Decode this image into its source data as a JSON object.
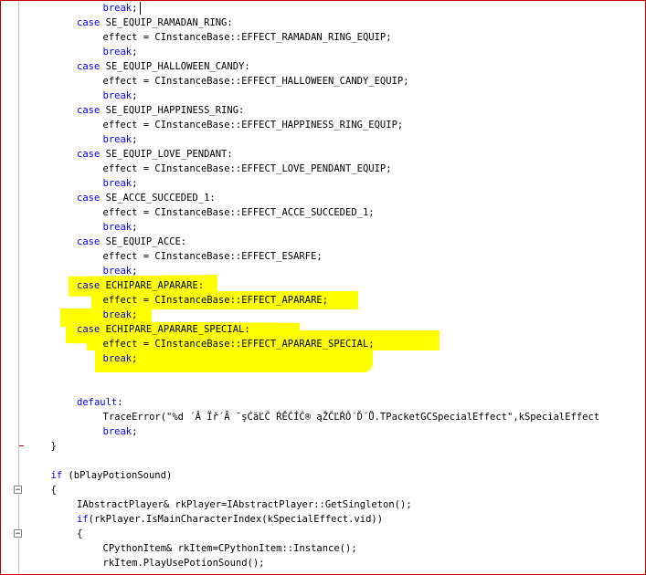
{
  "editor": {
    "lines": [
      {
        "indent": 3,
        "kw": "break",
        "text": ";"
      },
      {
        "indent": 2,
        "kw": "case",
        "text": " SE_EQUIP_RAMADAN_RING:"
      },
      {
        "indent": 3,
        "kw": "",
        "text": "effect = CInstanceBase::EFFECT_RAMADAN_RING_EQUIP;"
      },
      {
        "indent": 3,
        "kw": "break",
        "text": ";"
      },
      {
        "indent": 2,
        "kw": "case",
        "text": " SE_EQUIP_HALLOWEEN_CANDY:"
      },
      {
        "indent": 3,
        "kw": "",
        "text": "effect = CInstanceBase::EFFECT_HALLOWEEN_CANDY_EQUIP;"
      },
      {
        "indent": 3,
        "kw": "break",
        "text": ";"
      },
      {
        "indent": 2,
        "kw": "case",
        "text": " SE_EQUIP_HAPPINESS_RING:"
      },
      {
        "indent": 3,
        "kw": "",
        "text": "effect = CInstanceBase::EFFECT_HAPPINESS_RING_EQUIP;"
      },
      {
        "indent": 3,
        "kw": "break",
        "text": ";"
      },
      {
        "indent": 2,
        "kw": "case",
        "text": " SE_EQUIP_LOVE_PENDANT:"
      },
      {
        "indent": 3,
        "kw": "",
        "text": "effect = CInstanceBase::EFFECT_LOVE_PENDANT_EQUIP;"
      },
      {
        "indent": 3,
        "kw": "break",
        "text": ";"
      },
      {
        "indent": 2,
        "kw": "case",
        "text": " SE_ACCE_SUCCEDED_1:"
      },
      {
        "indent": 3,
        "kw": "",
        "text": "effect = CInstanceBase::EFFECT_ACCE_SUCCEDED_1;"
      },
      {
        "indent": 3,
        "kw": "break",
        "text": ";"
      },
      {
        "indent": 2,
        "kw": "case",
        "text": " SE_EQUIP_ACCE:"
      },
      {
        "indent": 3,
        "kw": "",
        "text": "effect = CInstanceBase::EFFECT_ESARFE;"
      },
      {
        "indent": 3,
        "kw": "break",
        "text": ";"
      },
      {
        "indent": 2,
        "kw": "case",
        "text": " ECHIPARE_APARARE:"
      },
      {
        "indent": 3,
        "kw": "",
        "text": "effect = CInstanceBase::EFFECT_APARARE;"
      },
      {
        "indent": 3,
        "kw": "break",
        "text": ";"
      },
      {
        "indent": 2,
        "kw": "case",
        "text": " ECHIPARE_APARARE_SPECIAL:"
      },
      {
        "indent": 3,
        "kw": "",
        "text": "effect = CInstanceBase::EFFECT_APARARE_SPECIAL;"
      },
      {
        "indent": 3,
        "kw": "break",
        "text": ";"
      },
      {
        "indent": 0,
        "kw": "",
        "text": ""
      },
      {
        "indent": 0,
        "kw": "",
        "text": ""
      },
      {
        "indent": 2,
        "kw": "default",
        "text": ":"
      },
      {
        "indent": 3,
        "kw": "",
        "text": "TraceError(\"%d ´Â Ïř´Â ˘şĆăĽČ ŔĚĆÍĆ® ąŽČĽŔÔ´Ď´Ů.TPacketGCSpecialEffect\",kSpecialEffect"
      },
      {
        "indent": 3,
        "kw": "break",
        "text": ";"
      },
      {
        "indent": 1,
        "kw": "",
        "text": "}"
      },
      {
        "indent": 0,
        "kw": "",
        "text": ""
      },
      {
        "indent": 1,
        "kw": "if",
        "text": " (bPlayPotionSound)"
      },
      {
        "indent": 1,
        "kw": "",
        "text": "{"
      },
      {
        "indent": 2,
        "kw": "",
        "text": "IAbstractPlayer& rkPlayer=IAbstractPlayer::GetSingleton();"
      },
      {
        "indent": 2,
        "kw": "if",
        "text": "(rkPlayer.IsMainCharacterIndex(kSpecialEffect.vid))"
      },
      {
        "indent": 2,
        "kw": "",
        "text": "{"
      },
      {
        "indent": 3,
        "kw": "",
        "text": "CPythonItem& rkItem=CPythonItem::Instance();"
      },
      {
        "indent": 3,
        "kw": "",
        "text": "rkItem.PlayUsePotionSound();"
      }
    ],
    "fold_markers": [
      "−",
      "−"
    ]
  }
}
